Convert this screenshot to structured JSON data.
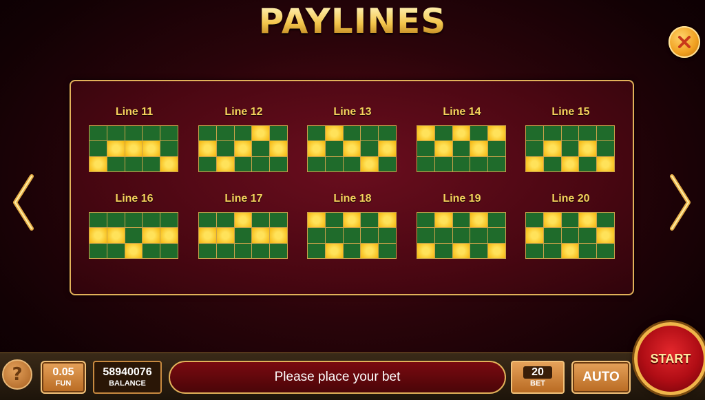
{
  "title": "PAYLINES",
  "lines": [
    {
      "label": "Line 11",
      "pattern": [
        [
          0,
          0,
          0,
          0,
          0
        ],
        [
          0,
          1,
          1,
          1,
          0
        ],
        [
          1,
          0,
          0,
          0,
          1
        ]
      ]
    },
    {
      "label": "Line 12",
      "pattern": [
        [
          0,
          0,
          0,
          1,
          0
        ],
        [
          1,
          0,
          1,
          0,
          1
        ],
        [
          0,
          1,
          0,
          0,
          0
        ]
      ]
    },
    {
      "label": "Line 13",
      "pattern": [
        [
          0,
          1,
          0,
          0,
          0
        ],
        [
          1,
          0,
          1,
          0,
          1
        ],
        [
          0,
          0,
          0,
          1,
          0
        ]
      ]
    },
    {
      "label": "Line 14",
      "pattern": [
        [
          1,
          0,
          1,
          0,
          1
        ],
        [
          0,
          1,
          0,
          1,
          0
        ],
        [
          0,
          0,
          0,
          0,
          0
        ]
      ]
    },
    {
      "label": "Line 15",
      "pattern": [
        [
          0,
          0,
          0,
          0,
          0
        ],
        [
          0,
          1,
          0,
          1,
          0
        ],
        [
          1,
          0,
          1,
          0,
          1
        ]
      ]
    },
    {
      "label": "Line 16",
      "pattern": [
        [
          0,
          0,
          0,
          0,
          0
        ],
        [
          1,
          1,
          0,
          1,
          1
        ],
        [
          0,
          0,
          1,
          0,
          0
        ]
      ]
    },
    {
      "label": "Line 17",
      "pattern": [
        [
          0,
          0,
          1,
          0,
          0
        ],
        [
          1,
          1,
          0,
          1,
          1
        ],
        [
          0,
          0,
          0,
          0,
          0
        ]
      ]
    },
    {
      "label": "Line 18",
      "pattern": [
        [
          1,
          0,
          1,
          0,
          1
        ],
        [
          0,
          0,
          0,
          0,
          0
        ],
        [
          0,
          1,
          0,
          1,
          0
        ]
      ]
    },
    {
      "label": "Line 19",
      "pattern": [
        [
          0,
          1,
          0,
          1,
          0
        ],
        [
          0,
          0,
          0,
          0,
          0
        ],
        [
          1,
          0,
          1,
          0,
          1
        ]
      ]
    },
    {
      "label": "Line 20",
      "pattern": [
        [
          0,
          1,
          0,
          1,
          0
        ],
        [
          1,
          0,
          0,
          0,
          1
        ],
        [
          0,
          0,
          1,
          0,
          0
        ]
      ]
    }
  ],
  "bottom": {
    "coin_value": "0.05",
    "coin_label": "FUN",
    "balance_value": "58940076",
    "balance_label": "BALANCE",
    "message": "Please place your bet",
    "bet_value": "20",
    "bet_label": "BET",
    "auto_label": "AUTO",
    "start_label": "START"
  },
  "icons": {
    "close": "close-icon",
    "help": "question-icon",
    "prev": "chevron-left-icon",
    "next": "chevron-right-icon"
  },
  "colors": {
    "gold": "#f5d25c",
    "reel_cell": "#1f6b2b",
    "highlight": "#ffc800",
    "accent_red": "#b00d15"
  }
}
